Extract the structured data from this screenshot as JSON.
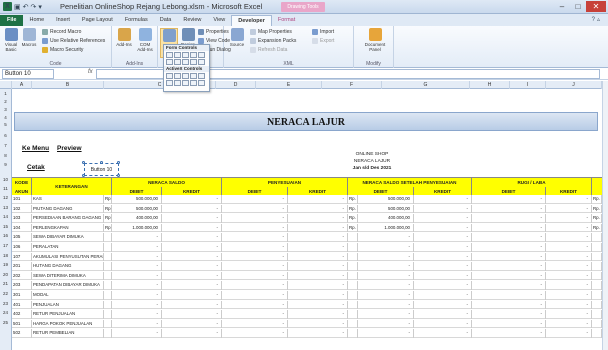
{
  "window": {
    "title": "Penelitian OnlineShop Rejang Lebong.xlsm - Microsoft Excel",
    "context_tab": "Drawing Tools",
    "controls": {
      "minimize": "–",
      "maximize": "□",
      "close": "✕"
    }
  },
  "ribbon_tabs": [
    {
      "label": "File"
    },
    {
      "label": "Home"
    },
    {
      "label": "Insert"
    },
    {
      "label": "Page Layout"
    },
    {
      "label": "Formulas"
    },
    {
      "label": "Data"
    },
    {
      "label": "Review"
    },
    {
      "label": "View"
    },
    {
      "label": "Developer"
    },
    {
      "label": "Format"
    }
  ],
  "ribbon": {
    "code": {
      "label": "Code",
      "visual_basic": "Visual Basic",
      "macros": "Macros",
      "record_macro": "Record Macro",
      "relative_refs": "Use Relative References",
      "macro_security": "Macro Security"
    },
    "addins": {
      "label": "Add-Ins",
      "addins_btn": "Add-Ins",
      "com_addins": "COM Add-Ins"
    },
    "controls": {
      "insert": "Insert",
      "design_mode": "Design Mode",
      "properties": "Properties",
      "view_code": "View Code",
      "run_dialog": "Run Dialog"
    },
    "xml": {
      "label": "XML",
      "source": "Source",
      "map_properties": "Map Properties",
      "expansion_packs": "Expansion Packs",
      "refresh_data": "Refresh Data",
      "import": "Import",
      "export": "Export"
    },
    "modify": {
      "label": "Modify",
      "document_panel": "Document Panel"
    }
  },
  "dropdown": {
    "form_controls": "Form Controls",
    "activex_controls": "ActiveX Controls"
  },
  "namebox": "Button 10",
  "fx": "fx",
  "columns": [
    "A",
    "B",
    "C",
    "D",
    "E",
    "F",
    "G",
    "H",
    "I",
    "J"
  ],
  "rows": [
    "1",
    "2",
    "3",
    "4",
    "5",
    "6",
    "7",
    "8",
    "9",
    "10",
    "11",
    "12",
    "13",
    "14",
    "15",
    "16",
    "17",
    "18",
    "19",
    "20",
    "21",
    "22",
    "23",
    "24",
    "25"
  ],
  "sheet": {
    "title": "NERACA LAJUR",
    "menu_btn": "Ke Menu",
    "preview_btn": "Preview",
    "cetak_btn": "Cetak",
    "selected_btn": "Button 10",
    "company": [
      "ONLINE SHOP",
      "NERACA LAJUR",
      "Jan s/d Des 2021"
    ]
  },
  "table": {
    "h_kode": "KODE",
    "h_akun": "AKUN",
    "h_ket": "KETERANGAN",
    "groups": [
      "NERACA SALDO",
      "PENYESUAIAN",
      "NERACA SALDO SETELAH PENYESUAIAN",
      "RUGI / LABA"
    ],
    "debit": "DEBIT",
    "kredit": "KREDIT",
    "rows": [
      {
        "kode": "101",
        "ket": "KAS",
        "rp": "Rp.",
        "debit": "500.000,00",
        "kredit": "-",
        "pd": "-",
        "pk": "-",
        "rp2": "Rp.",
        "sd": "500.000,00",
        "sk": "-",
        "ld": "-",
        "lk": "-",
        "rp3": "Rp."
      },
      {
        "kode": "102",
        "ket": "PIUTANG DAGANG",
        "rp": "Rp.",
        "debit": "500.000,00",
        "kredit": "-",
        "pd": "-",
        "pk": "-",
        "rp2": "Rp.",
        "sd": "500.000,00",
        "sk": "-",
        "ld": "-",
        "lk": "-",
        "rp3": "Rp."
      },
      {
        "kode": "103",
        "ket": "PERSEDIAAN BARANG DAGANG",
        "rp": "Rp.",
        "debit": "400.000,00",
        "kredit": "-",
        "pd": "-",
        "pk": "-",
        "rp2": "Rp.",
        "sd": "400.000,00",
        "sk": "-",
        "ld": "-",
        "lk": "-",
        "rp3": "Rp."
      },
      {
        "kode": "104",
        "ket": "PERLENGKAPAN",
        "rp": "Rp.",
        "debit": "1.000.000,00",
        "kredit": "-",
        "pd": "-",
        "pk": "-",
        "rp2": "Rp.",
        "sd": "1.000.000,00",
        "sk": "-",
        "ld": "-",
        "lk": "-",
        "rp3": "Rp."
      },
      {
        "kode": "105",
        "ket": "SEWA DIBAYAR DIMUKA",
        "rp": "",
        "debit": "-",
        "kredit": "-",
        "pd": "-",
        "pk": "-",
        "rp2": "",
        "sd": "-",
        "sk": "-",
        "ld": "-",
        "lk": "-",
        "rp3": ""
      },
      {
        "kode": "106",
        "ket": "PERALATAN",
        "rp": "",
        "debit": "-",
        "kredit": "-",
        "pd": "-",
        "pk": "-",
        "rp2": "",
        "sd": "-",
        "sk": "-",
        "ld": "-",
        "lk": "-",
        "rp3": ""
      },
      {
        "kode": "107",
        "ket": "AKUMULASI PENYUSUTAN PERALA",
        "rp": "",
        "debit": "-",
        "kredit": "-",
        "pd": "-",
        "pk": "-",
        "rp2": "",
        "sd": "-",
        "sk": "-",
        "ld": "-",
        "lk": "-",
        "rp3": ""
      },
      {
        "kode": "201",
        "ket": "HUTANG DAGANG",
        "rp": "",
        "debit": "-",
        "kredit": "-",
        "pd": "-",
        "pk": "-",
        "rp2": "",
        "sd": "-",
        "sk": "-",
        "ld": "-",
        "lk": "-",
        "rp3": ""
      },
      {
        "kode": "202",
        "ket": "SEWA DITERIMA DIMUKA",
        "rp": "",
        "debit": "-",
        "kredit": "-",
        "pd": "-",
        "pk": "-",
        "rp2": "",
        "sd": "-",
        "sk": "-",
        "ld": "-",
        "lk": "-",
        "rp3": ""
      },
      {
        "kode": "203",
        "ket": "PENDAPATAN DIBAYAR DIMUKA",
        "rp": "",
        "debit": "-",
        "kredit": "-",
        "pd": "-",
        "pk": "-",
        "rp2": "",
        "sd": "-",
        "sk": "-",
        "ld": "-",
        "lk": "-",
        "rp3": ""
      },
      {
        "kode": "301",
        "ket": "MODAL",
        "rp": "",
        "debit": "-",
        "kredit": "-",
        "pd": "-",
        "pk": "-",
        "rp2": "",
        "sd": "-",
        "sk": "-",
        "ld": "-",
        "lk": "-",
        "rp3": ""
      },
      {
        "kode": "401",
        "ket": "PENJUALAN",
        "rp": "",
        "debit": "-",
        "kredit": "-",
        "pd": "-",
        "pk": "-",
        "rp2": "",
        "sd": "-",
        "sk": "-",
        "ld": "-",
        "lk": "-",
        "rp3": ""
      },
      {
        "kode": "402",
        "ket": "RETUR PENJUALAN",
        "rp": "",
        "debit": "-",
        "kredit": "-",
        "pd": "-",
        "pk": "-",
        "rp2": "",
        "sd": "-",
        "sk": "-",
        "ld": "-",
        "lk": "-",
        "rp3": ""
      },
      {
        "kode": "501",
        "ket": "HARGA POKOK PENJUALAN",
        "rp": "",
        "debit": "-",
        "kredit": "-",
        "pd": "-",
        "pk": "-",
        "rp2": "",
        "sd": "-",
        "sk": "-",
        "ld": "-",
        "lk": "-",
        "rp3": ""
      },
      {
        "kode": "502",
        "ket": "RETUR PEMBELIAN",
        "rp": "",
        "debit": "-",
        "kredit": "-",
        "pd": "-",
        "pk": "-",
        "rp2": "",
        "sd": "-",
        "sk": "-",
        "ld": "-",
        "lk": "-",
        "rp3": ""
      }
    ]
  }
}
